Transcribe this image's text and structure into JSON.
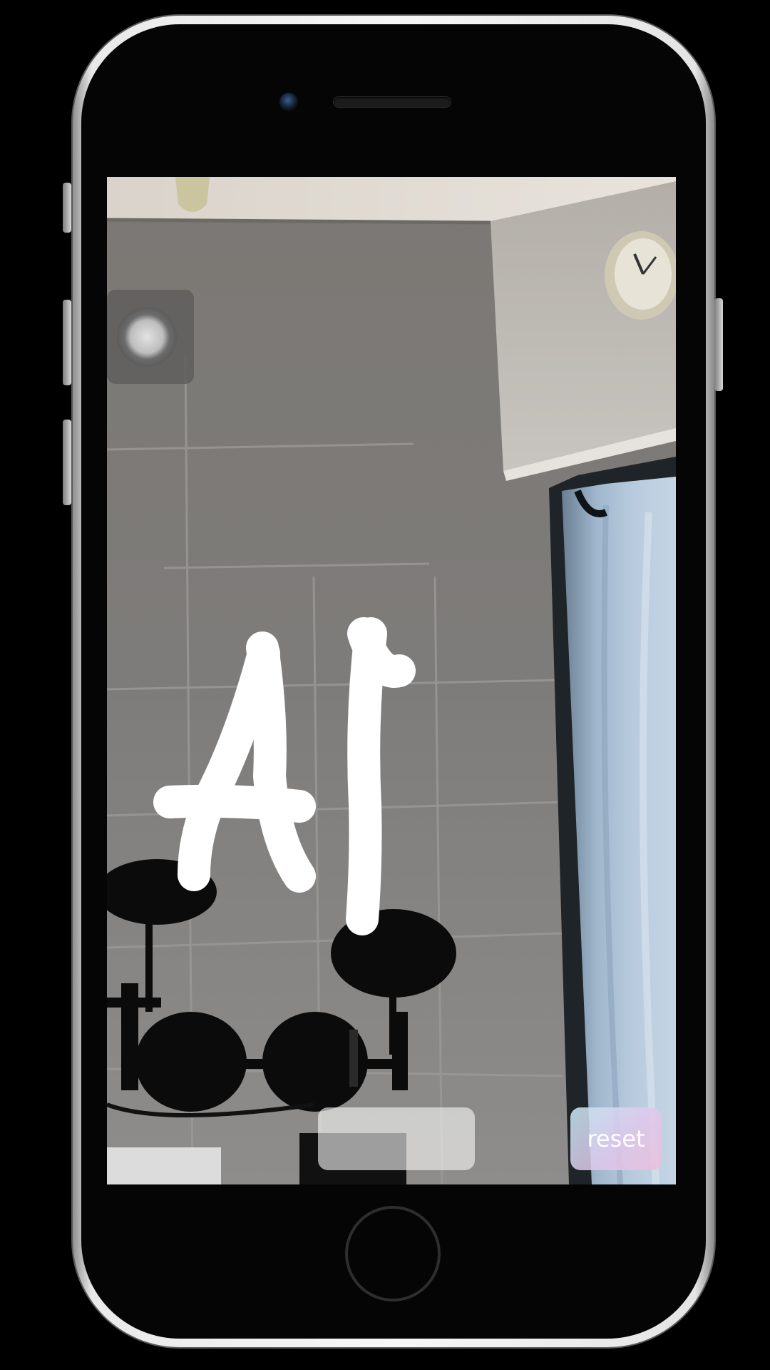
{
  "app": {
    "reset_label": "reset",
    "capture_label": "",
    "drawn_text": "AI",
    "stroke_color": "#ffffff"
  },
  "icons": {
    "camera": "front-camera-icon",
    "speaker": "earpiece-speaker-icon",
    "home": "home-button-icon"
  }
}
